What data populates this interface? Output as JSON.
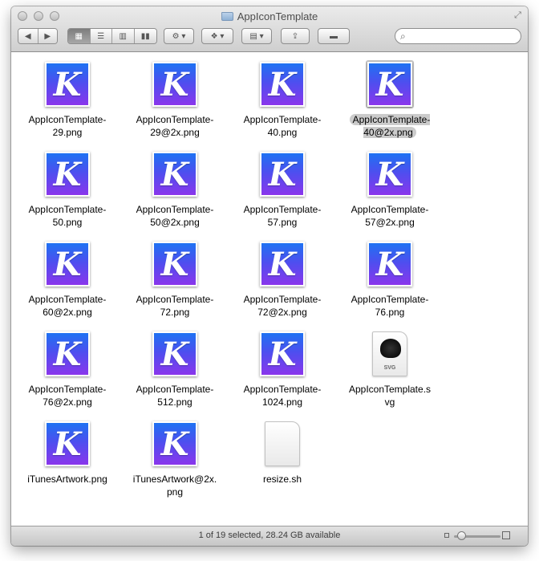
{
  "window": {
    "title": "AppIconTemplate"
  },
  "toolbar": {
    "back_icon": "back-arrow-icon",
    "forward_icon": "forward-arrow-icon",
    "view_modes": [
      "icon-view",
      "list-view",
      "column-view",
      "cover-flow-view"
    ],
    "active_view": "icon-view",
    "search_placeholder": ""
  },
  "files": [
    {
      "name": "AppIconTemplate-\n29.png",
      "kind": "app-icon",
      "selected": false
    },
    {
      "name": "AppIconTemplate-\n29@2x.png",
      "kind": "app-icon",
      "selected": false
    },
    {
      "name": "AppIconTemplate-\n40.png",
      "kind": "app-icon",
      "selected": false
    },
    {
      "name": "AppIconTemplate-\n40@2x.png",
      "kind": "app-icon",
      "selected": true
    },
    {
      "name": "AppIconTemplate-\n50.png",
      "kind": "app-icon",
      "selected": false
    },
    {
      "name": "AppIconTemplate-\n50@2x.png",
      "kind": "app-icon",
      "selected": false
    },
    {
      "name": "AppIconTemplate-\n57.png",
      "kind": "app-icon",
      "selected": false
    },
    {
      "name": "AppIconTemplate-\n57@2x.png",
      "kind": "app-icon",
      "selected": false
    },
    {
      "name": "AppIconTemplate-\n60@2x.png",
      "kind": "app-icon",
      "selected": false
    },
    {
      "name": "AppIconTemplate-\n72.png",
      "kind": "app-icon",
      "selected": false
    },
    {
      "name": "AppIconTemplate-\n72@2x.png",
      "kind": "app-icon",
      "selected": false
    },
    {
      "name": "AppIconTemplate-\n76.png",
      "kind": "app-icon",
      "selected": false
    },
    {
      "name": "AppIconTemplate-\n76@2x.png",
      "kind": "app-icon",
      "selected": false
    },
    {
      "name": "AppIconTemplate-\n512.png",
      "kind": "app-icon",
      "selected": false
    },
    {
      "name": "AppIconTemplate-\n1024.png",
      "kind": "app-icon",
      "selected": false
    },
    {
      "name": "AppIconTemplate.s\nvg",
      "kind": "svg-document",
      "selected": false
    },
    {
      "name": "iTunesArtwork.png",
      "kind": "app-icon",
      "selected": false
    },
    {
      "name": "iTunesArtwork@2x.\npng",
      "kind": "app-icon",
      "selected": false
    },
    {
      "name": "resize.sh",
      "kind": "plain-document",
      "selected": false
    }
  ],
  "icon_letter": "K",
  "svg_badge_label": "SVG",
  "status": {
    "text": "1 of 19 selected, 28.24 GB available"
  },
  "icon_size_slider": 0.15,
  "colors": {
    "icon_gradient_top": "#1e72f2",
    "icon_gradient_bottom": "#8a36ec",
    "selection": "#c8c8c8"
  }
}
